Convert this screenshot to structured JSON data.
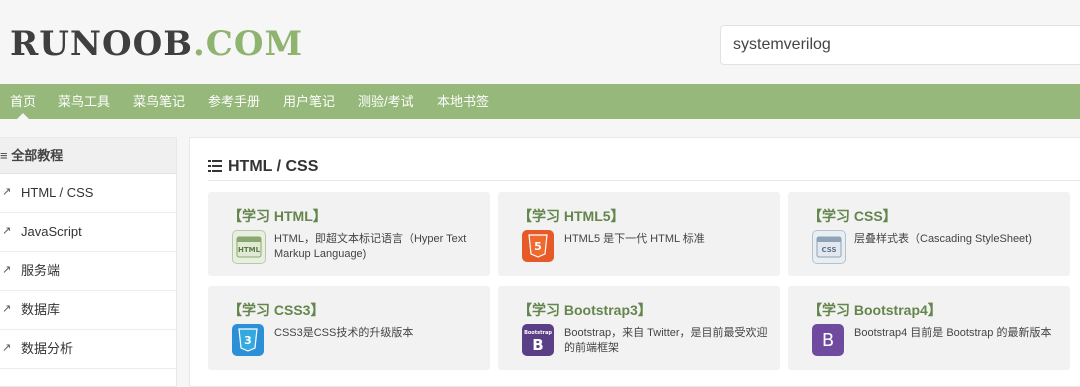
{
  "logo": {
    "part1": "RUNOOB",
    "part2": ".COM"
  },
  "search": {
    "value": "systemverilog"
  },
  "nav": {
    "items": [
      "首页",
      "菜鸟工具",
      "菜鸟笔记",
      "参考手册",
      "用户笔记",
      "测验/考试",
      "本地书签"
    ]
  },
  "sidebar": {
    "heading": "≡ 全部教程",
    "items": [
      "HTML / CSS",
      "JavaScript",
      "服务端",
      "数据库",
      "数据分析"
    ]
  },
  "main": {
    "title": "HTML / CSS",
    "cards": [
      {
        "title": "【学习 HTML】",
        "desc": "HTML，即超文本标记语言（Hyper Text Markup Language)",
        "icon": "html-icon"
      },
      {
        "title": "【学习 HTML5】",
        "desc": "HTML5 是下一代 HTML 标准",
        "icon": "html5-icon"
      },
      {
        "title": "【学习 CSS】",
        "desc": "层叠样式表（Cascading StyleSheet)",
        "icon": "css-icon"
      },
      {
        "title": "【学习 CSS3】",
        "desc": "CSS3是CSS技术的升级版本",
        "icon": "css3-icon"
      },
      {
        "title": "【学习 Bootstrap3】",
        "desc": "Bootstrap，来自 Twitter，是目前最受欢迎的前端框架",
        "icon": "bootstrap3-icon"
      },
      {
        "title": "【学习 Bootstrap4】",
        "desc": "Bootstrap4 目前是 Bootstrap 的最新版本",
        "icon": "bootstrap4-icon"
      }
    ]
  },
  "colors": {
    "brand_green": "#96b97b",
    "logo_green": "#8fb46f",
    "card_title": "#64854c"
  }
}
